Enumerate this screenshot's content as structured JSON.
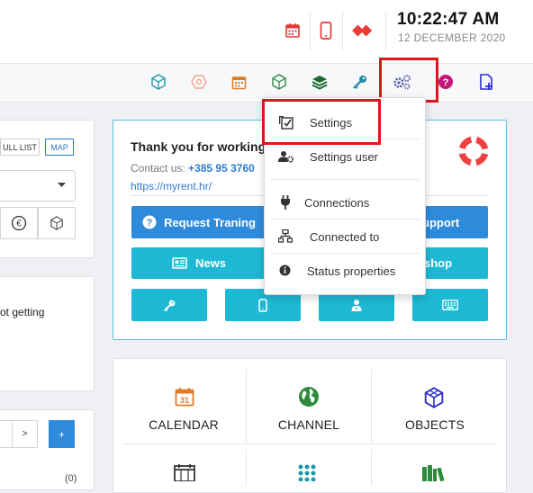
{
  "header": {
    "time": "10:22:47 AM",
    "date": "12 DECEMBER 2020"
  },
  "icons": {
    "calendar_red": "calendar-icon",
    "mobile_red": "mobile-icon",
    "anydesk": "anydesk-icon",
    "cube": "cube-icon",
    "gears": "gears-icon",
    "help": "help-icon",
    "new_document": "new-document-icon"
  },
  "left": {
    "full_list_label": "ULL LIST",
    "map_label": "MAP",
    "notice_text": "ot getting",
    "pagination_next": ">",
    "pagination_add": "+",
    "count": "(0)"
  },
  "welcome": {
    "title": "Thank you for working",
    "contact_label": "Contact us:",
    "phone": "+385 95 3760",
    "website": "https://myrent.hr/",
    "buttons": {
      "request_training": "Request Traning",
      "support": "upport",
      "news": "News",
      "shop": "shop"
    }
  },
  "dropdown_menu": {
    "items": [
      {
        "label": "Settings"
      },
      {
        "label": "Settings user"
      },
      {
        "label": "Connections"
      },
      {
        "label": "Connected to"
      },
      {
        "label": "Status properties"
      }
    ]
  },
  "modules": {
    "calendar": "CALENDAR",
    "channel": "CHANNEL",
    "objects": "OBJECTS"
  },
  "colors": {
    "accent_blue": "#2e8bdb",
    "accent_cyan": "#1db9d4",
    "highlight_red": "#e0141e",
    "link_blue": "#2e7dd1"
  }
}
